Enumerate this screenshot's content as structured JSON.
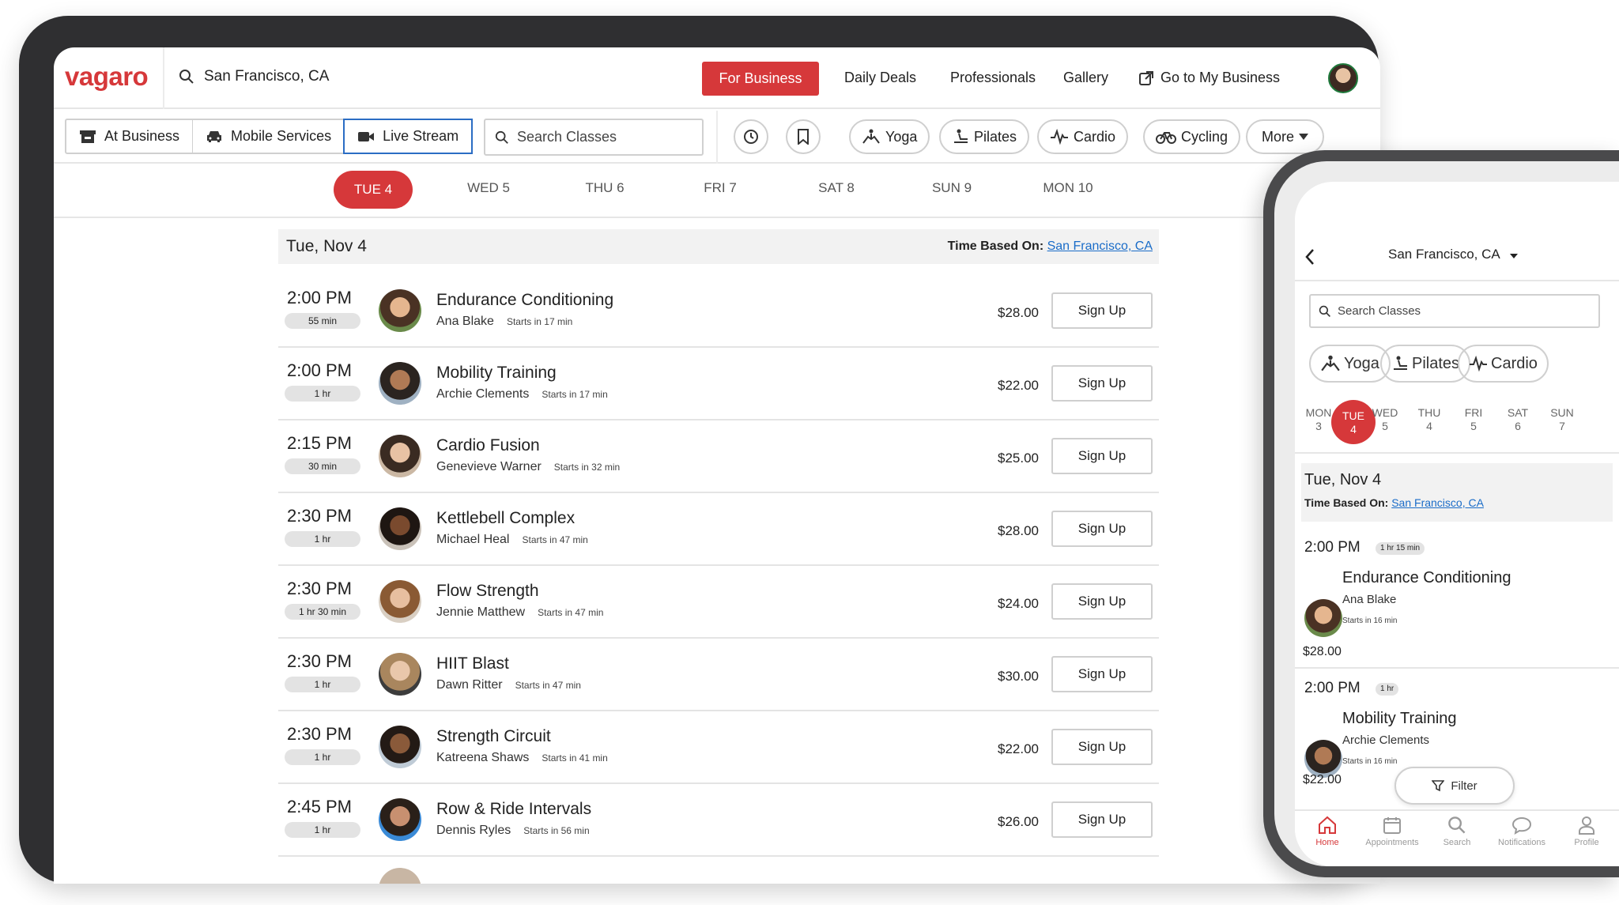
{
  "brand": {
    "logo": "vagaro",
    "accent": "#d6383a",
    "link": "#1a6cc8"
  },
  "topnav": {
    "location": "San Francisco, CA",
    "for_business": "For Business",
    "links": [
      "Daily Deals",
      "Professionals",
      "Gallery",
      "Go to My Business"
    ]
  },
  "filters": {
    "segments": [
      "At Business",
      "Mobile Services",
      "Live Stream"
    ],
    "active_segment": "Live Stream",
    "search_placeholder": "Search Classes",
    "categories": [
      "Yoga",
      "Pilates",
      "Cardio",
      "Cycling"
    ],
    "more": "More"
  },
  "days": [
    "TUE 4",
    "WED 5",
    "THU 6",
    "FRI 7",
    "SAT 8",
    "SUN 9",
    "MON 10"
  ],
  "active_day": "TUE 4",
  "schedule": {
    "date_title": "Tue, Nov 4",
    "time_based_label": "Time Based On:",
    "time_based_location": "San Francisco, CA",
    "signup_label": "Sign Up",
    "classes": [
      {
        "time": "2:00 PM",
        "duration": "55 min",
        "name": "Endurance Conditioning",
        "instructor": "Ana Blake",
        "starts": "Starts in 17 min",
        "price": "$28.00"
      },
      {
        "time": "2:00 PM",
        "duration": "1 hr",
        "name": "Mobility Training",
        "instructor": "Archie Clements",
        "starts": "Starts in 17 min",
        "price": "$22.00"
      },
      {
        "time": "2:15 PM",
        "duration": "30 min",
        "name": "Cardio Fusion",
        "instructor": "Genevieve Warner",
        "starts": "Starts in 32 min",
        "price": "$25.00"
      },
      {
        "time": "2:30 PM",
        "duration": "1 hr",
        "name": "Kettlebell Complex",
        "instructor": "Michael Heal",
        "starts": "Starts in 47 min",
        "price": "$28.00"
      },
      {
        "time": "2:30 PM",
        "duration": "1 hr 30 min",
        "name": "Flow Strength",
        "instructor": "Jennie Matthew",
        "starts": "Starts in 47 min",
        "price": "$24.00"
      },
      {
        "time": "2:30 PM",
        "duration": "1 hr",
        "name": "HIIT Blast",
        "instructor": "Dawn Ritter",
        "starts": "Starts in 47 min",
        "price": "$30.00"
      },
      {
        "time": "2:30 PM",
        "duration": "1 hr",
        "name": "Strength Circuit",
        "instructor": "Katreena Shaws",
        "starts": "Starts in 41 min",
        "price": "$22.00"
      },
      {
        "time": "2:45 PM",
        "duration": "1 hr",
        "name": "Row & Ride Intervals",
        "instructor": "Dennis Ryles",
        "starts": "Starts in 56 min",
        "price": "$26.00"
      }
    ]
  },
  "phone": {
    "location": "San Francisco, CA",
    "search_placeholder": "Search Classes",
    "categories": [
      "Yoga",
      "Pilates",
      "Cardio"
    ],
    "days": [
      {
        "dow": "MON",
        "num": "3"
      },
      {
        "dow": "TUE",
        "num": "4"
      },
      {
        "dow": "WED",
        "num": "5"
      },
      {
        "dow": "THU",
        "num": "4"
      },
      {
        "dow": "FRI",
        "num": "5"
      },
      {
        "dow": "SAT",
        "num": "6"
      },
      {
        "dow": "SUN",
        "num": "7"
      }
    ],
    "date_title": "Tue, Nov 4",
    "time_based_label": "Time Based On:",
    "time_based_location": "San Francisco, CA",
    "classes": [
      {
        "time": "2:00 PM",
        "duration": "1 hr 15 min",
        "name": "Endurance Conditioning",
        "instructor": "Ana Blake",
        "starts": "Starts in 16 min",
        "price": "$28.00"
      },
      {
        "time": "2:00 PM",
        "duration": "1 hr",
        "name": "Mobility Training",
        "instructor": "Archie Clements",
        "starts": "Starts in 16 min",
        "price": "$22.00"
      }
    ],
    "filter_label": "Filter",
    "tabbar": [
      "Home",
      "Appointments",
      "Search",
      "Notifications",
      "Profile"
    ],
    "active_tab": "Home"
  }
}
